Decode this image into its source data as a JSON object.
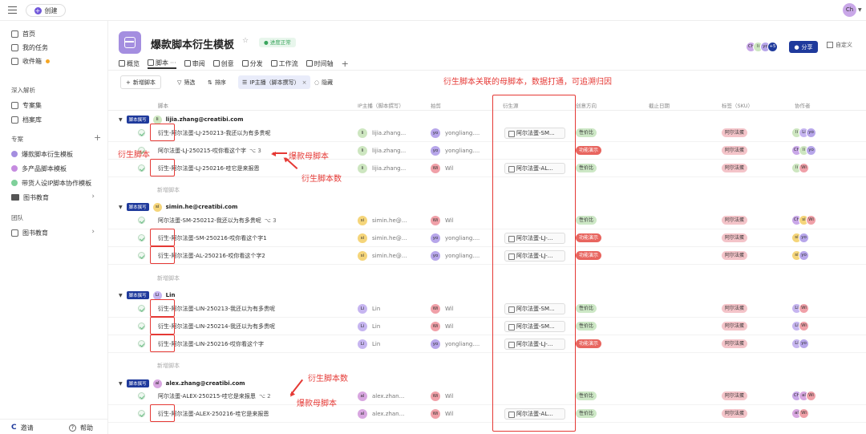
{
  "topbar": {
    "create_label": "创建",
    "user_initials": "Ch"
  },
  "sidebar": {
    "nav": [
      {
        "icon": "home-icon",
        "label": "首页"
      },
      {
        "icon": "task-icon",
        "label": "我的任务"
      },
      {
        "icon": "inbox-icon",
        "label": "收件箱"
      }
    ],
    "section_deep": "深入解析",
    "deep_items": [
      {
        "icon": "folder-outline-icon",
        "label": "专案集"
      },
      {
        "icon": "archive-icon",
        "label": "档案库"
      }
    ],
    "section_projects": "专案",
    "projects": [
      {
        "label": "爆款脚本衍生模板",
        "color": "#a48ee0"
      },
      {
        "label": "多产品脚本模板",
        "color": "#c58be0"
      },
      {
        "label": "带货人设IP脚本协作模板",
        "color": "#7fd09a"
      },
      {
        "label": "图书教育",
        "color": "#555555"
      }
    ],
    "section_team": "团队",
    "team_items": [
      {
        "label": "图书教育"
      }
    ],
    "bottom": {
      "invite": "邀请",
      "help": "帮助"
    }
  },
  "project": {
    "title": "爆款脚本衍生模板",
    "status": "进度正常",
    "share_label": "分享",
    "custom_label": "自定义",
    "member_avatars": [
      "Ch",
      "li",
      "yo",
      "+5"
    ],
    "tabs": [
      "概览",
      "脚本",
      "审阅",
      "创意",
      "分发",
      "工作流",
      "时间轴"
    ]
  },
  "toolbar": {
    "new_label": "新增脚本",
    "filter_label": "筛选",
    "sort_label": "排序",
    "chip_label": "IP主播（脚本撰写）",
    "hide_label": "隐藏"
  },
  "columns": [
    "脚本",
    "IP主播（脚本撰写）",
    "拍剪",
    "衍生源",
    "创意方向",
    "截止日期",
    "标签（SKU）",
    "协作者"
  ],
  "add_script_label": "新增脚本",
  "groups": [
    {
      "tag": "脚本撰写",
      "initials": "li",
      "color": "#cde6c0",
      "name": "lijia.zhang@creatibi.com",
      "rows": [
        {
          "title": "衍生-阿尔法蛋-LJ-250213-我还以为有多贵呢",
          "count": "",
          "ip_initials": "li",
          "ip_name": "lijia.zhang...",
          "ip_color": "#cde6c0",
          "cut_initials": "yo",
          "cut_name": "yongliang....",
          "cut_color": "#b7a6ea",
          "source": "阿尔法蛋-SM...",
          "direction": "性价比",
          "dir_type": "g",
          "sku": "阿尔法蛋",
          "collab": [
            [
              "li",
              "#cde6c0"
            ],
            [
              "Li",
              "#c6b5f0"
            ],
            [
              "yo",
              "#b7a6ea"
            ]
          ]
        },
        {
          "title": "阿尔法蛋-LJ-250215-哎你看这个字",
          "count": "3",
          "ip_initials": "li",
          "ip_name": "lijia.zhang...",
          "ip_color": "#cde6c0",
          "cut_initials": "yo",
          "cut_name": "yongliang....",
          "cut_color": "#b7a6ea",
          "source": "",
          "direction": "功能演示",
          "dir_type": "r",
          "sku": "阿尔法蛋",
          "collab": [
            [
              "Ch",
              "#c9a7e8"
            ],
            [
              "li",
              "#cde6c0"
            ],
            [
              "yo",
              "#b7a6ea"
            ]
          ]
        },
        {
          "title": "衍生-阿尔法蛋-LJ-250216-哇它是来报恩",
          "count": "",
          "ip_initials": "li",
          "ip_name": "lijia.zhang...",
          "ip_color": "#cde6c0",
          "cut_initials": "Wi",
          "cut_name": "Wil",
          "cut_color": "#f0a0a8",
          "source": "阿尔法蛋-AL...",
          "direction": "性价比",
          "dir_type": "g",
          "sku": "阿尔法蛋",
          "collab": [
            [
              "li",
              "#cde6c0"
            ],
            [
              "Wi",
              "#f0a0a8"
            ]
          ]
        }
      ]
    },
    {
      "tag": "脚本撰写",
      "initials": "si",
      "color": "#f5d57a",
      "name": "simin.he@creatibi.com",
      "rows": [
        {
          "title": "阿尔法蛋-SM-250212-我还以为有多贵呢",
          "count": "3",
          "ip_initials": "si",
          "ip_name": "simin.he@...",
          "ip_color": "#f5d57a",
          "cut_initials": "Wi",
          "cut_name": "Wil",
          "cut_color": "#f0a0a8",
          "source": "",
          "direction": "性价比",
          "dir_type": "g",
          "sku": "阿尔法蛋",
          "collab": [
            [
              "Ch",
              "#c9a7e8"
            ],
            [
              "si",
              "#f5d57a"
            ],
            [
              "Wi",
              "#f0a0a8"
            ]
          ]
        },
        {
          "title": "衍生-阿尔法蛋-SM-250216-哎你看这个字1",
          "count": "",
          "ip_initials": "si",
          "ip_name": "simin.he@...",
          "ip_color": "#f5d57a",
          "cut_initials": "yo",
          "cut_name": "yongliang....",
          "cut_color": "#b7a6ea",
          "source": "阿尔法蛋-LJ-...",
          "direction": "功能演示",
          "dir_type": "r",
          "sku": "阿尔法蛋",
          "collab": [
            [
              "si",
              "#f5d57a"
            ],
            [
              "yo",
              "#b7a6ea"
            ]
          ]
        },
        {
          "title": "衍生-阿尔法蛋-AL-250216-哎你看这个字2",
          "count": "",
          "ip_initials": "si",
          "ip_name": "simin.he@...",
          "ip_color": "#f5d57a",
          "cut_initials": "yo",
          "cut_name": "yongliang....",
          "cut_color": "#b7a6ea",
          "source": "阿尔法蛋-LJ-...",
          "direction": "功能演示",
          "dir_type": "r",
          "sku": "阿尔法蛋",
          "collab": [
            [
              "si",
              "#f5d57a"
            ],
            [
              "yo",
              "#b7a6ea"
            ]
          ]
        }
      ]
    },
    {
      "tag": "脚本撰写",
      "initials": "Li",
      "color": "#c6b5f0",
      "name": "Lin",
      "rows": [
        {
          "title": "衍生-阿尔法蛋-LIN-250213-我还以为有多贵呢",
          "count": "",
          "ip_initials": "Li",
          "ip_name": "Lin",
          "ip_color": "#c6b5f0",
          "cut_initials": "Wi",
          "cut_name": "Wil",
          "cut_color": "#f0a0a8",
          "source": "阿尔法蛋-SM...",
          "direction": "性价比",
          "dir_type": "g",
          "sku": "阿尔法蛋",
          "collab": [
            [
              "Li",
              "#c6b5f0"
            ],
            [
              "Wi",
              "#f0a0a8"
            ]
          ]
        },
        {
          "title": "衍生-阿尔法蛋-LIN-250214-我还以为有多贵呢",
          "count": "",
          "ip_initials": "Li",
          "ip_name": "Lin",
          "ip_color": "#c6b5f0",
          "cut_initials": "Wi",
          "cut_name": "Wil",
          "cut_color": "#f0a0a8",
          "source": "阿尔法蛋-SM...",
          "direction": "性价比",
          "dir_type": "g",
          "sku": "阿尔法蛋",
          "collab": [
            [
              "Li",
              "#c6b5f0"
            ],
            [
              "Wi",
              "#f0a0a8"
            ]
          ]
        },
        {
          "title": "衍生-阿尔法蛋-LIN-250216-哎你看这个字",
          "count": "",
          "ip_initials": "Li",
          "ip_name": "Lin",
          "ip_color": "#c6b5f0",
          "cut_initials": "yo",
          "cut_name": "yongliang....",
          "cut_color": "#b7a6ea",
          "source": "阿尔法蛋-LJ-...",
          "direction": "功能演示",
          "dir_type": "r",
          "sku": "阿尔法蛋",
          "collab": [
            [
              "Li",
              "#c6b5f0"
            ],
            [
              "yo",
              "#b7a6ea"
            ]
          ]
        }
      ]
    },
    {
      "tag": "脚本撰写",
      "initials": "al",
      "color": "#d8a6e0",
      "name": "alex.zhang@creatibi.com",
      "rows": [
        {
          "title": "阿尔法蛋-ALEX-250215-哇它是来报恩",
          "count": "2",
          "ip_initials": "al",
          "ip_name": "alex.zhan...",
          "ip_color": "#d8a6e0",
          "cut_initials": "Wi",
          "cut_name": "Wil",
          "cut_color": "#f0a0a8",
          "source": "",
          "direction": "性价比",
          "dir_type": "g",
          "sku": "阿尔法蛋",
          "collab": [
            [
              "Ch",
              "#c9a7e8"
            ],
            [
              "al",
              "#d8a6e0"
            ],
            [
              "Wi",
              "#f0a0a8"
            ]
          ]
        },
        {
          "title": "衍生-阿尔法蛋-ALEX-250216-哇它是来报恩",
          "count": "",
          "ip_initials": "al",
          "ip_name": "alex.zhan...",
          "ip_color": "#d8a6e0",
          "cut_initials": "Wi",
          "cut_name": "Wil",
          "cut_color": "#f0a0a8",
          "source": "阿尔法蛋-AL...",
          "direction": "性价比",
          "dir_type": "g",
          "sku": "阿尔法蛋",
          "collab": [
            [
              "al",
              "#d8a6e0"
            ],
            [
              "Wi",
              "#f0a0a8"
            ]
          ]
        }
      ]
    }
  ],
  "annotations": {
    "source_note": "衍生脚本关联的母脚本，数据打通，可追溯归因",
    "derived_label": "衍生脚本",
    "parent_label_1": "爆款母脚本",
    "count_label_1": "衍生脚本数",
    "count_label_2": "衍生脚本数",
    "parent_label_2": "爆款母脚本"
  }
}
